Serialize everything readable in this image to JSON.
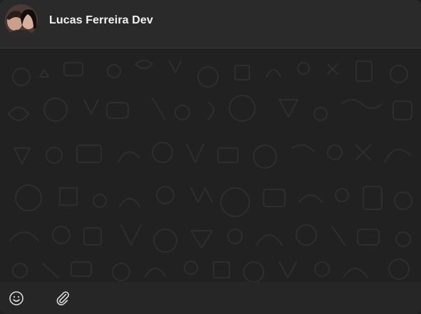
{
  "header": {
    "contact_name": "Lucas Ferreira Dev",
    "avatar_icon": "profile-photo"
  },
  "input_bar": {
    "emoji_icon": "emoji-icon",
    "attach_icon": "paperclip-icon"
  },
  "colors": {
    "header_bg": "#2a2a2a",
    "chat_bg": "#212121",
    "pattern": "#2c2c2c",
    "bottom_bg": "#262626",
    "text": "#f2f2f2",
    "icon": "#d9d9d9"
  }
}
